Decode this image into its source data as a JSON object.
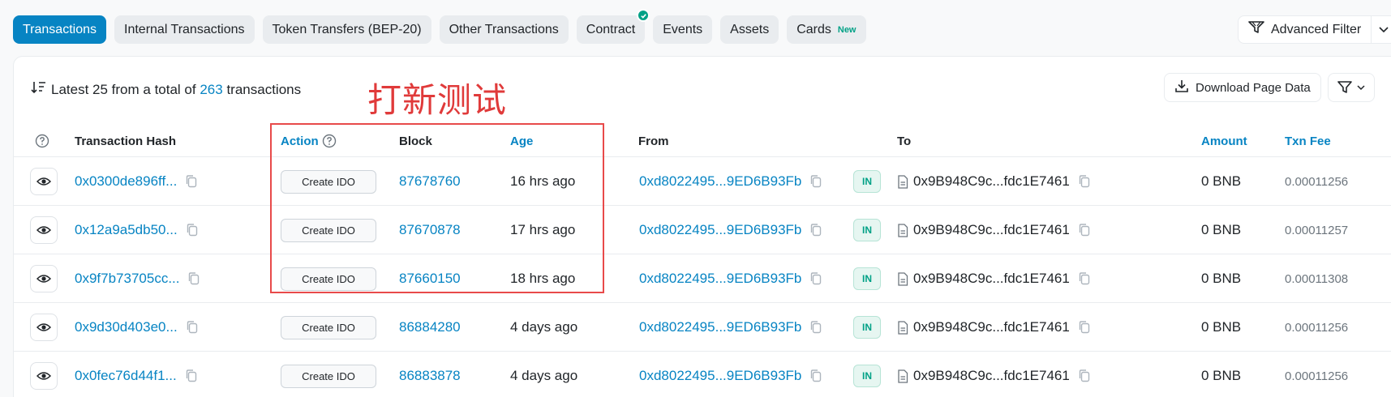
{
  "tabs": [
    {
      "label": "Transactions",
      "active": true
    },
    {
      "label": "Internal Transactions"
    },
    {
      "label": "Token Transfers (BEP-20)"
    },
    {
      "label": "Other Transactions"
    },
    {
      "label": "Contract",
      "verified": true
    },
    {
      "label": "Events"
    },
    {
      "label": "Assets"
    },
    {
      "label": "Cards",
      "badge": "New"
    }
  ],
  "advanced_filter": {
    "label": "Advanced Filter"
  },
  "summary": {
    "prefix": "Latest 25 from a total of ",
    "count": "263",
    "suffix": " transactions"
  },
  "annotation": "打新测试",
  "download": {
    "label": "Download Page Data"
  },
  "columns": {
    "hash": "Transaction Hash",
    "action": "Action",
    "block": "Block",
    "age": "Age",
    "from": "From",
    "to": "To",
    "amount": "Amount",
    "fee": "Txn Fee"
  },
  "rows": [
    {
      "hash": "0x0300de896ff...",
      "method": "Create IDO",
      "block": "87678760",
      "age": "16 hrs ago",
      "from": "0xd8022495...9ED6B93Fb",
      "dir": "IN",
      "to": "0x9B948C9c...fdc1E7461",
      "amount": "0 BNB",
      "fee": "0.00011256"
    },
    {
      "hash": "0x12a9a5db50...",
      "method": "Create IDO",
      "block": "87670878",
      "age": "17 hrs ago",
      "from": "0xd8022495...9ED6B93Fb",
      "dir": "IN",
      "to": "0x9B948C9c...fdc1E7461",
      "amount": "0 BNB",
      "fee": "0.00011257"
    },
    {
      "hash": "0x9f7b73705cc...",
      "method": "Create IDO",
      "block": "87660150",
      "age": "18 hrs ago",
      "from": "0xd8022495...9ED6B93Fb",
      "dir": "IN",
      "to": "0x9B948C9c...fdc1E7461",
      "amount": "0 BNB",
      "fee": "0.00011308"
    },
    {
      "hash": "0x9d30d403e0...",
      "method": "Create IDO",
      "block": "86884280",
      "age": "4 days ago",
      "from": "0xd8022495...9ED6B93Fb",
      "dir": "IN",
      "to": "0x9B948C9c...fdc1E7461",
      "amount": "0 BNB",
      "fee": "0.00011256"
    },
    {
      "hash": "0x0fec76d44f1...",
      "method": "Create IDO",
      "block": "86883878",
      "age": "4 days ago",
      "from": "0xd8022495...9ED6B93Fb",
      "dir": "IN",
      "to": "0x9B948C9c...fdc1E7461",
      "amount": "0 BNB",
      "fee": "0.00011256"
    }
  ],
  "colors": {
    "accent": "#0784c3",
    "success": "#00a186",
    "annotation": "#e03a3a"
  }
}
